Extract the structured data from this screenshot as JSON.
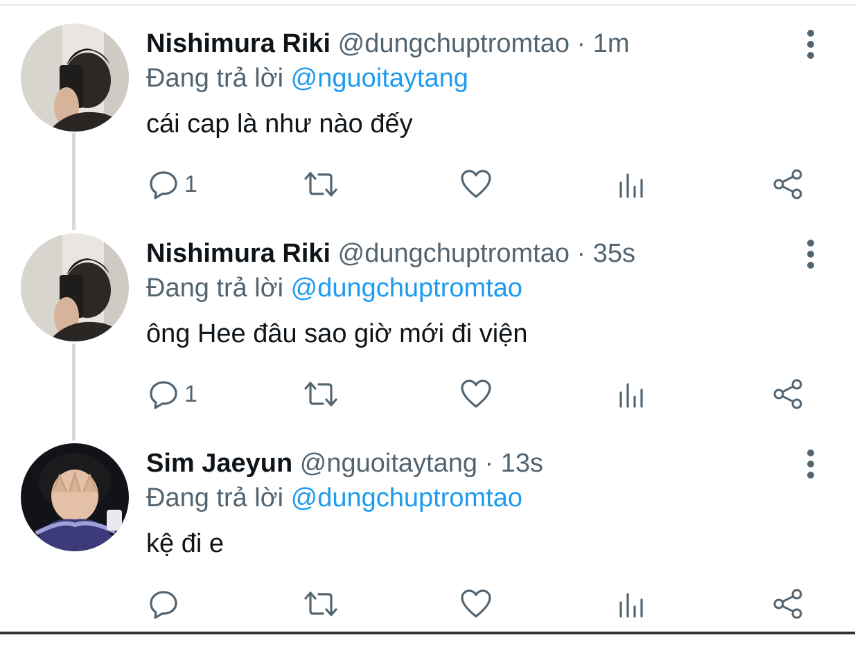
{
  "colors": {
    "link": "#1d9bf0",
    "secondary_text": "#536471",
    "primary_text": "#0f1419",
    "thread_line": "#d5d9dc"
  },
  "tweets": [
    {
      "display_name": "Nishimura Riki",
      "handle": "@dungchuptromtao",
      "separator": "·",
      "time": "1m",
      "reply_prefix": "Đang trả lời",
      "reply_to": "@nguoitaytang",
      "text": "cái cap là như nào đếy",
      "reply_count": "1",
      "avatar_icon": "profile-photo"
    },
    {
      "display_name": "Nishimura Riki",
      "handle": "@dungchuptromtao",
      "separator": "·",
      "time": "35s",
      "reply_prefix": "Đang trả lời",
      "reply_to": "@dungchuptromtao",
      "text": "ông Hee đâu sao giờ mới đi viện",
      "reply_count": "1",
      "avatar_icon": "profile-photo"
    },
    {
      "display_name": "Sim Jaeyun",
      "handle": "@nguoitaytang",
      "separator": "·",
      "time": "13s",
      "reply_prefix": "Đang trả lời",
      "reply_to": "@dungchuptromtao",
      "text": "kệ đi e",
      "reply_count": "",
      "avatar_icon": "profile-photo"
    }
  ],
  "action_icons": [
    "reply-icon",
    "retweet-icon",
    "like-icon",
    "analytics-icon",
    "share-icon"
  ],
  "overflow_icon": "more-vertical-icon"
}
